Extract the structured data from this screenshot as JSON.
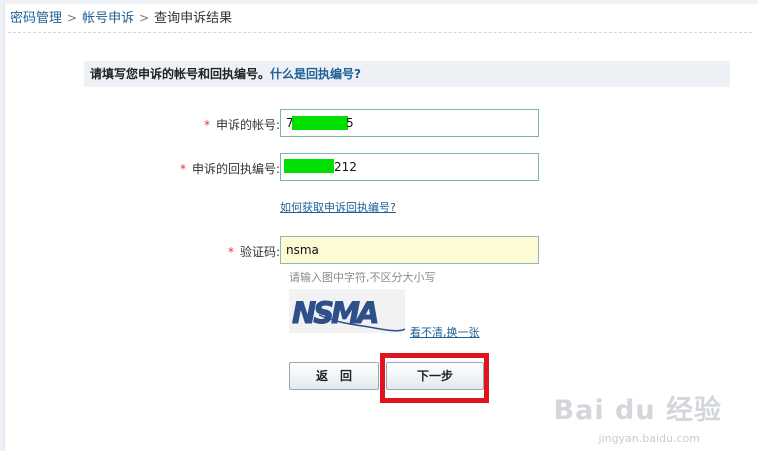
{
  "breadcrumb": {
    "item1": "密码管理",
    "item2": "帐号申诉",
    "current": "查询申诉结果",
    "separator": ">"
  },
  "notice": {
    "text": "请填写您申诉的帐号和回执编号。",
    "link": "什么是回执编号?"
  },
  "form": {
    "required_mark": "*",
    "account": {
      "label": "申诉的帐号:",
      "value_prefix": "7",
      "value_suffix": "5"
    },
    "receipt": {
      "label": "申诉的回执编号:",
      "value_suffix": "212"
    },
    "help_link": "如何获取申诉回执编号?",
    "captcha": {
      "label": "验证码:",
      "value": "nsma",
      "hint": "请输入图中字符,不区分大小写",
      "image_text": "NSMA",
      "refresh": "看不清,换一张"
    }
  },
  "buttons": {
    "back": "返　回",
    "next": "下一步"
  },
  "watermark": {
    "brand": "Bai du 经验",
    "url": "jingyan.baidu.com"
  },
  "colors": {
    "link": "#1f5f96",
    "required": "#e33333",
    "highlight": "#e0141e",
    "redaction": "#00e000",
    "captcha_field_bg": "#fdfbd3"
  }
}
